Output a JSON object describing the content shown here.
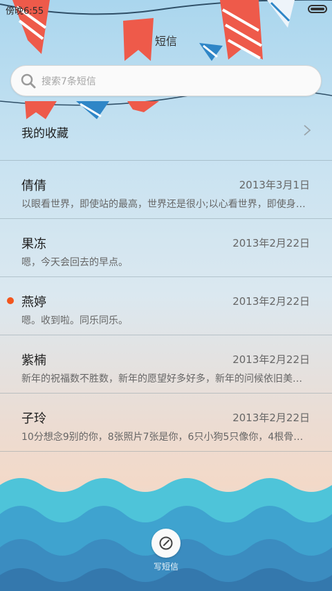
{
  "status": {
    "time": "傍晚6:55"
  },
  "header": {
    "title": "短信"
  },
  "search": {
    "placeholder": "搜索7条短信"
  },
  "favorites": {
    "label": "我的收藏"
  },
  "messages": [
    {
      "name": "倩倩",
      "date": "2013年3月1日",
      "preview": "以眼看世界，即使站的最高，世界还是很小;以心看世界，即使身…",
      "unread": false
    },
    {
      "name": "果冻",
      "date": "2013年2月22日",
      "preview": "嗯，今天会回去的早点。",
      "unread": false
    },
    {
      "name": "燕婷",
      "date": "2013年2月22日",
      "preview": "嗯。收到啦。同乐同乐。",
      "unread": true
    },
    {
      "name": "紫楠",
      "date": "2013年2月22日",
      "preview": "新年的祝福数不胜数，新年的愿望好多好多，新年的问候依旧美…",
      "unread": false
    },
    {
      "name": "子玲",
      "date": "2013年2月22日",
      "preview": "10分想念9别的你，8张照片7张是你，6只小狗5只像你，4根骨…",
      "unread": false
    }
  ],
  "compose": {
    "label": "写短信",
    "icon": "compose-icon"
  },
  "colors": {
    "unread_dot": "#f2561d",
    "flag_red": "#ee5a4a",
    "wave_light": "#4ec4d9",
    "wave_dark": "#3b8cc0"
  }
}
